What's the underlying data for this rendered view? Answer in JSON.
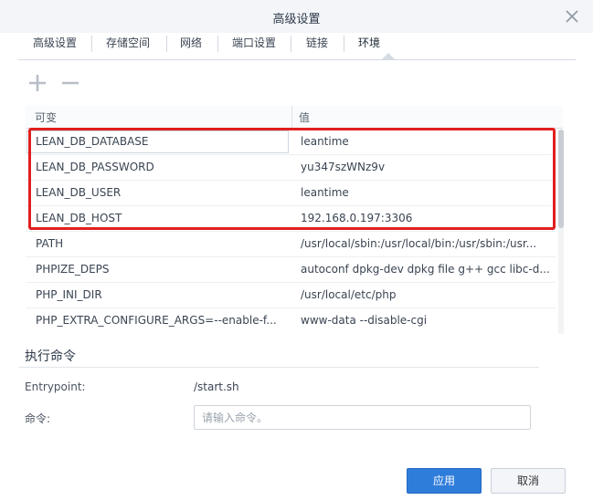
{
  "window": {
    "title": "高级设置"
  },
  "tabs": [
    {
      "label": "高级设置"
    },
    {
      "label": "存储空间"
    },
    {
      "label": "网络"
    },
    {
      "label": "端口设置"
    },
    {
      "label": "链接"
    },
    {
      "label": "环境"
    }
  ],
  "active_tab": "环境",
  "toolbar": {
    "add_icon": "plus-icon",
    "remove_icon": "minus-icon"
  },
  "env_table": {
    "headers": {
      "key": "可变",
      "value": "值"
    },
    "rows": [
      {
        "key": "LEAN_DB_DATABASE",
        "value": "leantime"
      },
      {
        "key": "LEAN_DB_PASSWORD",
        "value": "yu347szWNz9v"
      },
      {
        "key": "LEAN_DB_USER",
        "value": "leantime"
      },
      {
        "key": "LEAN_DB_HOST",
        "value": "192.168.0.197:3306"
      },
      {
        "key": "PATH",
        "value": "/usr/local/sbin:/usr/local/bin:/usr/sbin:/usr..."
      },
      {
        "key": "PHPIZE_DEPS",
        "value": "autoconf dpkg-dev dpkg file g++ gcc libc-d..."
      },
      {
        "key": "PHP_INI_DIR",
        "value": "/usr/local/etc/php"
      },
      {
        "key": "PHP_EXTRA_CONFIGURE_ARGS=--enable-f...",
        "value": "www-data --disable-cgi"
      }
    ]
  },
  "exec": {
    "section_title": "执行命令",
    "entrypoint_label": "Entrypoint:",
    "entrypoint_value": "/start.sh",
    "command_label": "命令:",
    "command_placeholder": "请输入命令。",
    "command_value": ""
  },
  "footer": {
    "apply_label": "应用",
    "cancel_label": "取消"
  },
  "colors": {
    "highlight": "#e11f1f",
    "primary": "#2f7ddb"
  }
}
